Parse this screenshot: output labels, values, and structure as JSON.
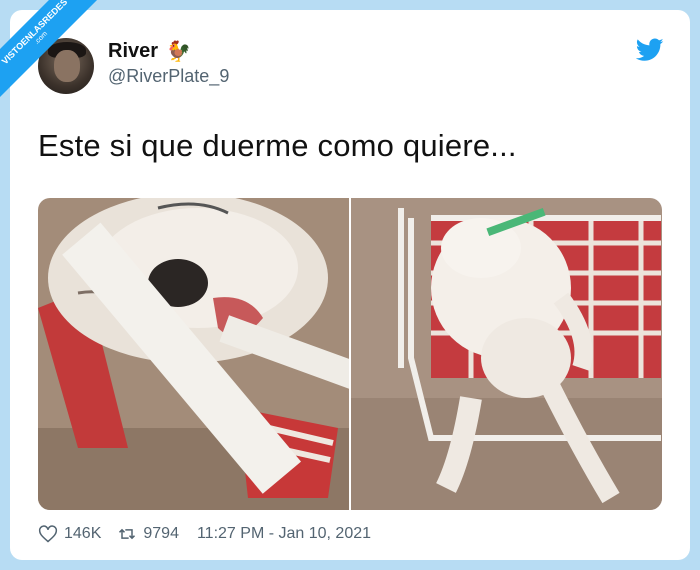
{
  "user": {
    "display_name": "River",
    "emoji": "🐓",
    "handle": "@RiverPlate_9"
  },
  "tweet": {
    "text": "Este si que duerme como quiere..."
  },
  "stats": {
    "likes": "146K",
    "retweets": "9794",
    "timestamp": "11:27 PM - Jan 10, 2021"
  },
  "watermark": {
    "brand": "VISTOENLASREDES",
    "domain": ".com"
  },
  "colors": {
    "twitter_blue": "#1da1f2",
    "page_background": "#b7dcf3",
    "muted_text": "#536471"
  },
  "icons": {
    "brand": "twitter-bird-icon",
    "like": "heart-icon",
    "retweet": "retweet-icon"
  }
}
